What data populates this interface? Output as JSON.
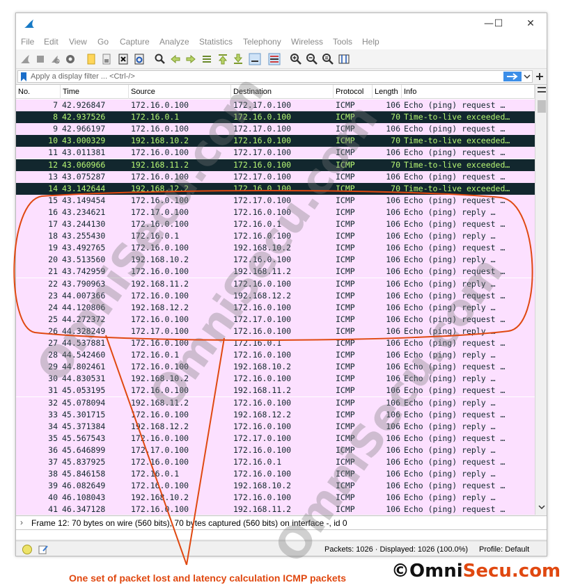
{
  "window": {
    "controls": [
      "—",
      "☐",
      "✕"
    ]
  },
  "menu": [
    "File",
    "Edit",
    "View",
    "Go",
    "Capture",
    "Analyze",
    "Statistics",
    "Telephony",
    "Wireless",
    "Tools",
    "Help"
  ],
  "filter": {
    "placeholder": "Apply a display filter ... <Ctrl-/>"
  },
  "columns": [
    "No.",
    "Time",
    "Source",
    "Destination",
    "Protocol",
    "Length",
    "Info"
  ],
  "rows": [
    {
      "no": "7",
      "time": "42.926847",
      "src": "172.16.0.100",
      "dst": "172.17.0.100",
      "proto": "ICMP",
      "len": "106",
      "info": "Echo (ping) request  …",
      "kind": "icmp"
    },
    {
      "no": "8",
      "time": "42.937526",
      "src": "172.16.0.1",
      "dst": "172.16.0.100",
      "proto": "ICMP",
      "len": "70",
      "info": "Time-to-live exceeded…",
      "kind": "ttl"
    },
    {
      "no": "9",
      "time": "42.966197",
      "src": "172.16.0.100",
      "dst": "172.17.0.100",
      "proto": "ICMP",
      "len": "106",
      "info": "Echo (ping) request  …",
      "kind": "icmp"
    },
    {
      "no": "10",
      "time": "43.000329",
      "src": "192.168.10.2",
      "dst": "172.16.0.100",
      "proto": "ICMP",
      "len": "70",
      "info": "Time-to-live exceeded…",
      "kind": "ttl"
    },
    {
      "no": "11",
      "time": "43.011381",
      "src": "172.16.0.100",
      "dst": "172.17.0.100",
      "proto": "ICMP",
      "len": "106",
      "info": "Echo (ping) request  …",
      "kind": "icmp"
    },
    {
      "no": "12",
      "time": "43.060966",
      "src": "192.168.11.2",
      "dst": "172.16.0.100",
      "proto": "ICMP",
      "len": "70",
      "info": "Time-to-live exceeded…",
      "kind": "ttl"
    },
    {
      "no": "13",
      "time": "43.075287",
      "src": "172.16.0.100",
      "dst": "172.17.0.100",
      "proto": "ICMP",
      "len": "106",
      "info": "Echo (ping) request  …",
      "kind": "icmp"
    },
    {
      "no": "14",
      "time": "43.142644",
      "src": "192.168.12.2",
      "dst": "172.16.0.100",
      "proto": "ICMP",
      "len": "70",
      "info": "Time-to-live exceeded…",
      "kind": "ttl"
    },
    {
      "no": "15",
      "time": "43.149454",
      "src": "172.16.0.100",
      "dst": "172.17.0.100",
      "proto": "ICMP",
      "len": "106",
      "info": "Echo (ping) request  …",
      "kind": "icmp"
    },
    {
      "no": "16",
      "time": "43.234621",
      "src": "172.17.0.100",
      "dst": "172.16.0.100",
      "proto": "ICMP",
      "len": "106",
      "info": "Echo (ping) reply    …",
      "kind": "icmp"
    },
    {
      "no": "17",
      "time": "43.244130",
      "src": "172.16.0.100",
      "dst": "172.16.0.1",
      "proto": "ICMP",
      "len": "106",
      "info": "Echo (ping) request  …",
      "kind": "icmp"
    },
    {
      "no": "18",
      "time": "43.255430",
      "src": "172.16.0.1",
      "dst": "172.16.0.100",
      "proto": "ICMP",
      "len": "106",
      "info": "Echo (ping) reply    …",
      "kind": "icmp"
    },
    {
      "no": "19",
      "time": "43.492765",
      "src": "172.16.0.100",
      "dst": "192.168.10.2",
      "proto": "ICMP",
      "len": "106",
      "info": "Echo (ping) request  …",
      "kind": "icmp"
    },
    {
      "no": "20",
      "time": "43.513560",
      "src": "192.168.10.2",
      "dst": "172.16.0.100",
      "proto": "ICMP",
      "len": "106",
      "info": "Echo (ping) reply    …",
      "kind": "icmp"
    },
    {
      "no": "21",
      "time": "43.742959",
      "src": "172.16.0.100",
      "dst": "192.168.11.2",
      "proto": "ICMP",
      "len": "106",
      "info": "Echo (ping) request  …",
      "kind": "icmp"
    },
    {
      "no": "22",
      "time": "43.790963",
      "src": "192.168.11.2",
      "dst": "172.16.0.100",
      "proto": "ICMP",
      "len": "106",
      "info": "Echo (ping) reply    …",
      "kind": "icmp"
    },
    {
      "no": "23",
      "time": "44.007366",
      "src": "172.16.0.100",
      "dst": "192.168.12.2",
      "proto": "ICMP",
      "len": "106",
      "info": "Echo (ping) request  …",
      "kind": "icmp"
    },
    {
      "no": "24",
      "time": "44.120806",
      "src": "192.168.12.2",
      "dst": "172.16.0.100",
      "proto": "ICMP",
      "len": "106",
      "info": "Echo (ping) reply    …",
      "kind": "icmp"
    },
    {
      "no": "25",
      "time": "44.272372",
      "src": "172.16.0.100",
      "dst": "172.17.0.100",
      "proto": "ICMP",
      "len": "106",
      "info": "Echo (ping) request  …",
      "kind": "icmp"
    },
    {
      "no": "26",
      "time": "44.328249",
      "src": "172.17.0.100",
      "dst": "172.16.0.100",
      "proto": "ICMP",
      "len": "106",
      "info": "Echo (ping) reply    …",
      "kind": "icmp"
    },
    {
      "no": "27",
      "time": "44.537881",
      "src": "172.16.0.100",
      "dst": "172.16.0.1",
      "proto": "ICMP",
      "len": "106",
      "info": "Echo (ping) request  …",
      "kind": "icmp"
    },
    {
      "no": "28",
      "time": "44.542460",
      "src": "172.16.0.1",
      "dst": "172.16.0.100",
      "proto": "ICMP",
      "len": "106",
      "info": "Echo (ping) reply    …",
      "kind": "icmp"
    },
    {
      "no": "29",
      "time": "44.802461",
      "src": "172.16.0.100",
      "dst": "192.168.10.2",
      "proto": "ICMP",
      "len": "106",
      "info": "Echo (ping) request  …",
      "kind": "icmp"
    },
    {
      "no": "30",
      "time": "44.830531",
      "src": "192.168.10.2",
      "dst": "172.16.0.100",
      "proto": "ICMP",
      "len": "106",
      "info": "Echo (ping) reply    …",
      "kind": "icmp"
    },
    {
      "no": "31",
      "time": "45.053195",
      "src": "172.16.0.100",
      "dst": "192.168.11.2",
      "proto": "ICMP",
      "len": "106",
      "info": "Echo (ping) request  …",
      "kind": "icmp"
    },
    {
      "no": "32",
      "time": "45.078094",
      "src": "192.168.11.2",
      "dst": "172.16.0.100",
      "proto": "ICMP",
      "len": "106",
      "info": "Echo (ping) reply    …",
      "kind": "icmp"
    },
    {
      "no": "33",
      "time": "45.301715",
      "src": "172.16.0.100",
      "dst": "192.168.12.2",
      "proto": "ICMP",
      "len": "106",
      "info": "Echo (ping) request  …",
      "kind": "icmp"
    },
    {
      "no": "34",
      "time": "45.371384",
      "src": "192.168.12.2",
      "dst": "172.16.0.100",
      "proto": "ICMP",
      "len": "106",
      "info": "Echo (ping) reply    …",
      "kind": "icmp"
    },
    {
      "no": "35",
      "time": "45.567543",
      "src": "172.16.0.100",
      "dst": "172.17.0.100",
      "proto": "ICMP",
      "len": "106",
      "info": "Echo (ping) request  …",
      "kind": "icmp"
    },
    {
      "no": "36",
      "time": "45.646899",
      "src": "172.17.0.100",
      "dst": "172.16.0.100",
      "proto": "ICMP",
      "len": "106",
      "info": "Echo (ping) reply    …",
      "kind": "icmp"
    },
    {
      "no": "37",
      "time": "45.837925",
      "src": "172.16.0.100",
      "dst": "172.16.0.1",
      "proto": "ICMP",
      "len": "106",
      "info": "Echo (ping) request  …",
      "kind": "icmp"
    },
    {
      "no": "38",
      "time": "45.846158",
      "src": "172.16.0.1",
      "dst": "172.16.0.100",
      "proto": "ICMP",
      "len": "106",
      "info": "Echo (ping) reply    …",
      "kind": "icmp"
    },
    {
      "no": "39",
      "time": "46.082649",
      "src": "172.16.0.100",
      "dst": "192.168.10.2",
      "proto": "ICMP",
      "len": "106",
      "info": "Echo (ping) request  …",
      "kind": "icmp"
    },
    {
      "no": "40",
      "time": "46.108043",
      "src": "192.168.10.2",
      "dst": "172.16.0.100",
      "proto": "ICMP",
      "len": "106",
      "info": "Echo (ping) reply    …",
      "kind": "icmp"
    },
    {
      "no": "41",
      "time": "46.347128",
      "src": "172.16.0.100",
      "dst": "192.168.11.2",
      "proto": "ICMP",
      "len": "106",
      "info": "Echo (ping) request  …",
      "kind": "icmp"
    }
  ],
  "detail": {
    "frame": "Frame 12: 70 bytes on wire (560 bits), 70 bytes captured (560 bits) on interface -, id 0"
  },
  "status": {
    "packets": "Packets: 1026 · Displayed: 1026 (100.0%)",
    "profile": "Profile: Default"
  },
  "watermark": "OmniSecu.com",
  "annotation": {
    "caption": "One set of packet lost and latency calculation ICMP packets",
    "brand_prefix": "©Omni",
    "brand_mid": "Secu",
    "brand_suffix": ".com"
  },
  "colors": {
    "icmp_row_bg": "#fce0ff",
    "ttl_row_bg": "#12272e",
    "ttl_row_fg": "#b7f774",
    "annotation": "#e04810"
  }
}
